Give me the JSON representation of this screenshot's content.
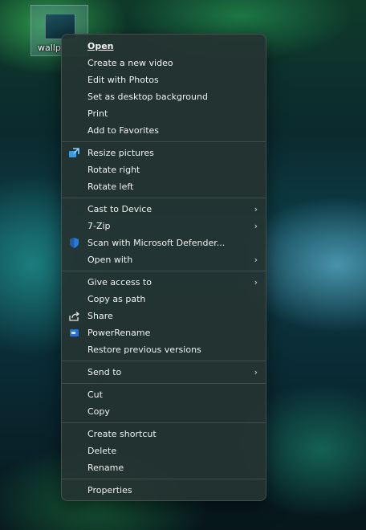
{
  "desktop": {
    "file_label": "wallp"
  },
  "menu": {
    "groups": [
      [
        {
          "label": "Open",
          "bold": true
        },
        {
          "label": "Create a new video"
        },
        {
          "label": "Edit with Photos"
        },
        {
          "label": "Set as desktop background"
        },
        {
          "label": "Print"
        },
        {
          "label": "Add to Favorites"
        }
      ],
      [
        {
          "label": "Resize pictures",
          "icon": "image-resizer-icon"
        },
        {
          "label": "Rotate right"
        },
        {
          "label": "Rotate left"
        }
      ],
      [
        {
          "label": "Cast to Device",
          "submenu": true
        },
        {
          "label": "7-Zip",
          "submenu": true
        },
        {
          "label": "Scan with Microsoft Defender...",
          "icon": "defender-shield-icon"
        },
        {
          "label": "Open with",
          "submenu": true
        }
      ],
      [
        {
          "label": "Give access to",
          "submenu": true
        },
        {
          "label": "Copy as path"
        },
        {
          "label": "Share",
          "icon": "share-icon"
        },
        {
          "label": "PowerRename",
          "icon": "powerrename-icon"
        },
        {
          "label": "Restore previous versions"
        }
      ],
      [
        {
          "label": "Send to",
          "submenu": true
        }
      ],
      [
        {
          "label": "Cut"
        },
        {
          "label": "Copy"
        }
      ],
      [
        {
          "label": "Create shortcut"
        },
        {
          "label": "Delete"
        },
        {
          "label": "Rename"
        }
      ],
      [
        {
          "label": "Properties"
        }
      ]
    ],
    "submenu_glyph": "›",
    "colors": {
      "background": "#253432",
      "text": "#f2f2f2",
      "defender_blue": "#2b7bd6",
      "resize_blue": "#3a9be6"
    }
  }
}
